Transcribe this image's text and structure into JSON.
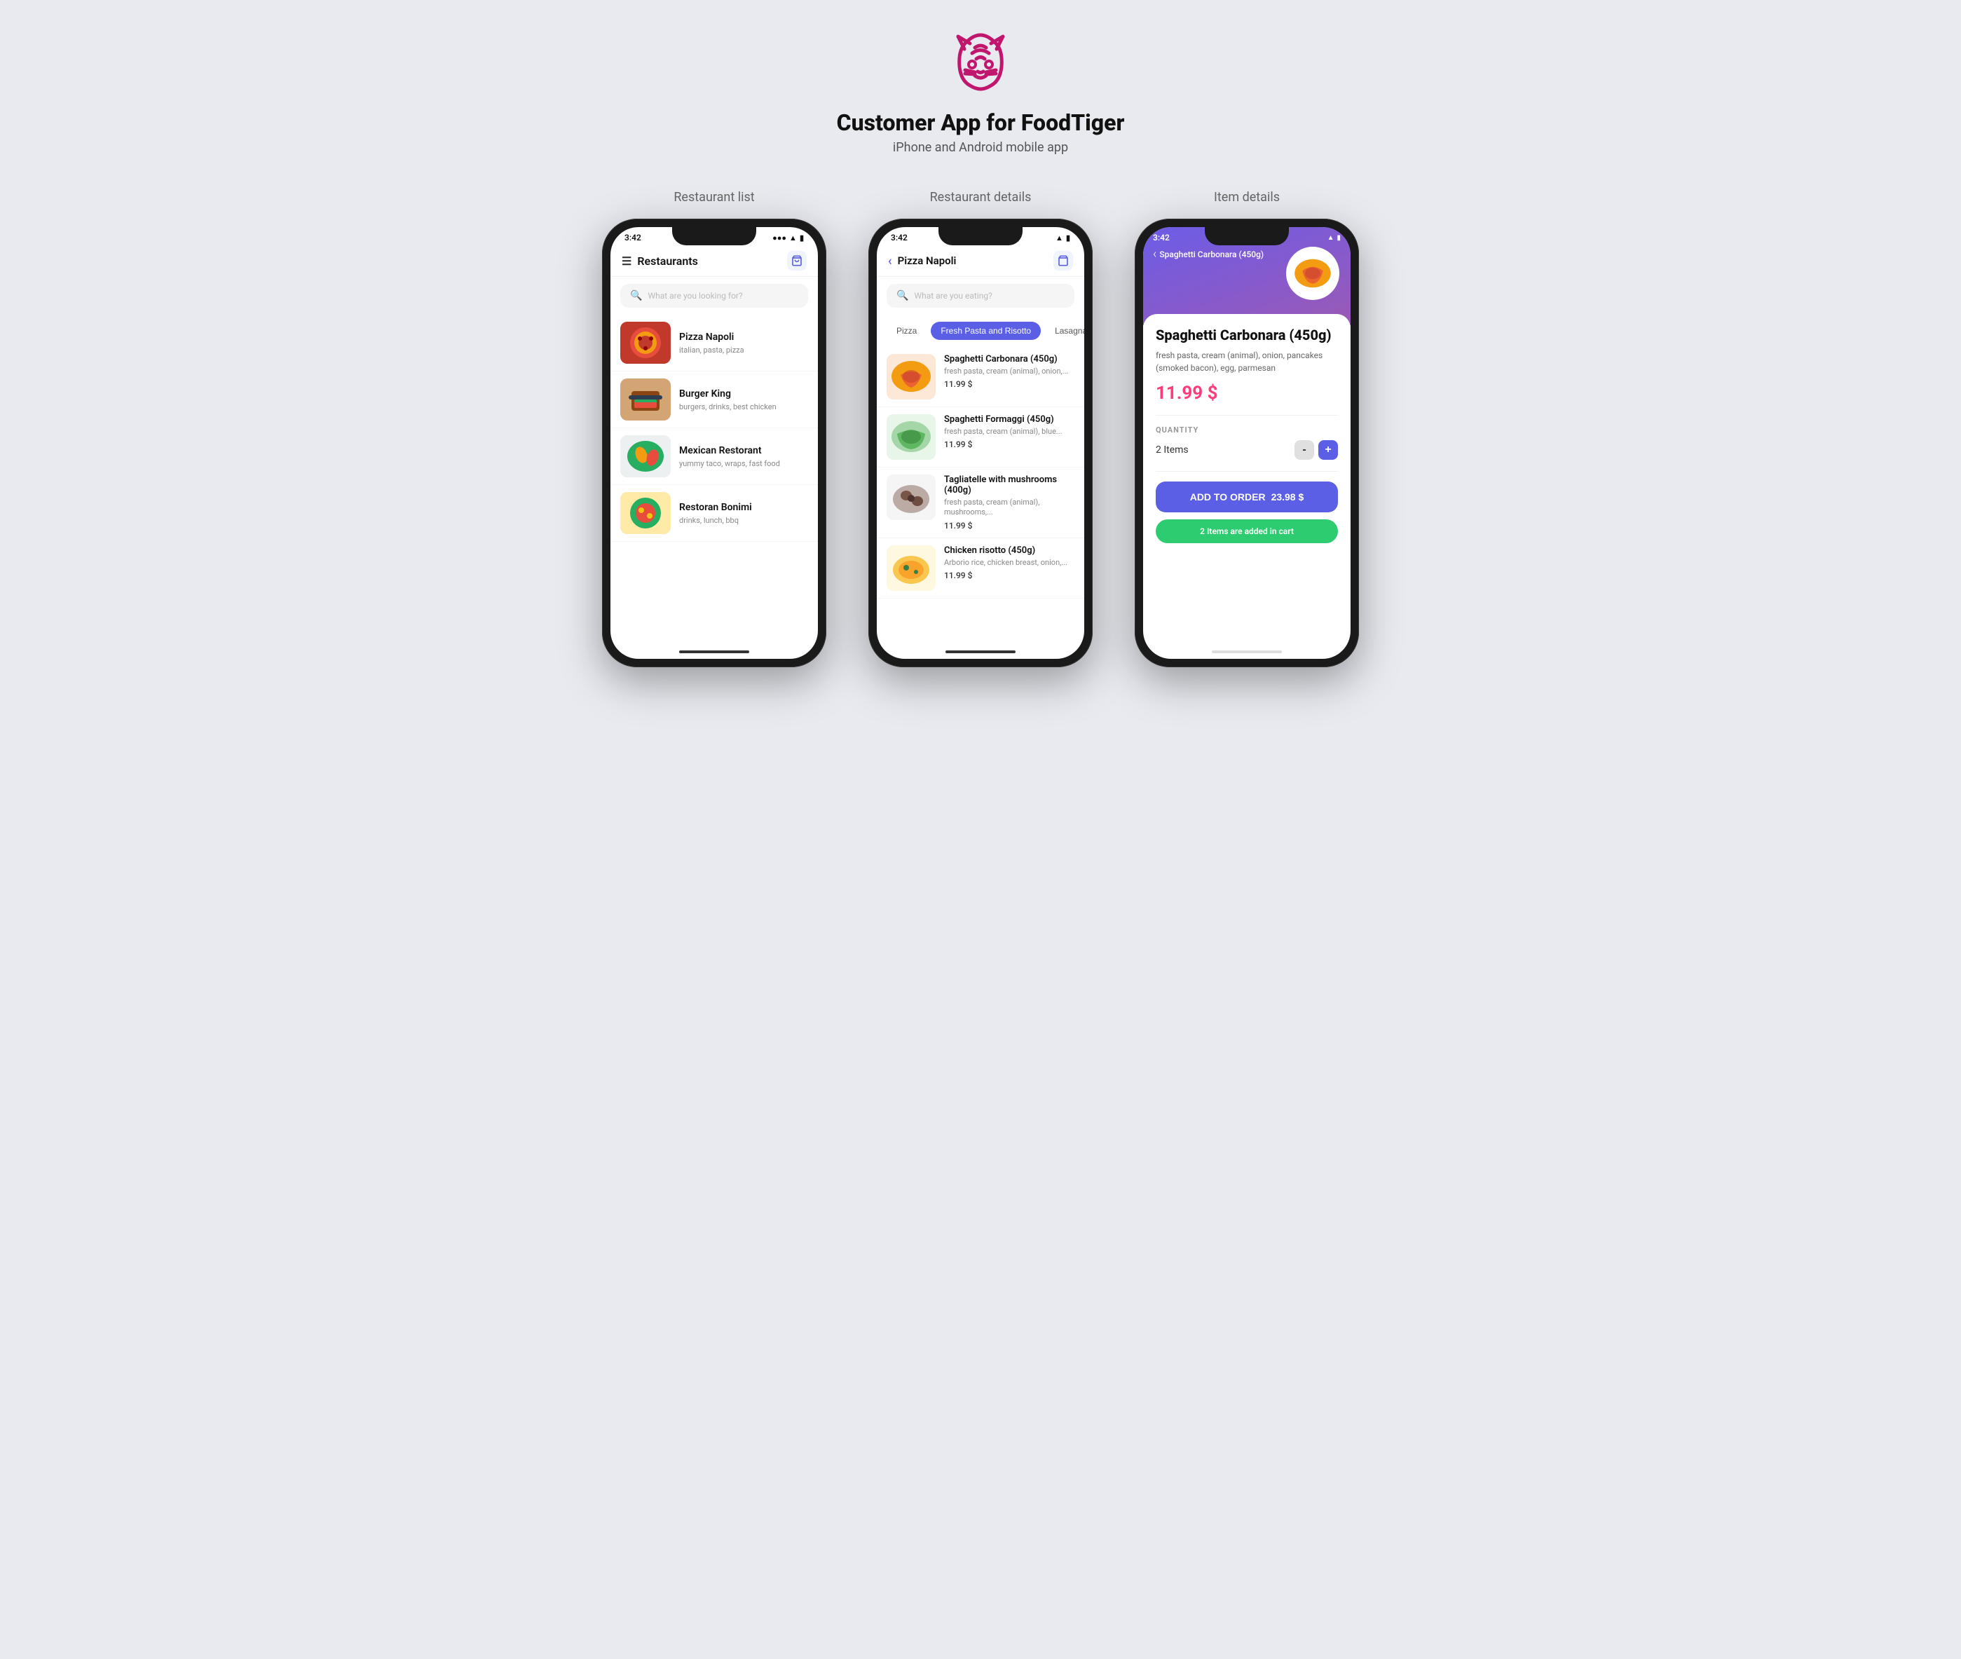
{
  "app": {
    "logo_alt": "FoodTiger tiger logo",
    "title": "Customer App for FoodTiger",
    "subtitle": "iPhone and Android mobile app"
  },
  "sections": [
    {
      "label": "Restaurant list"
    },
    {
      "label": "Restaurant details"
    },
    {
      "label": "Item details"
    }
  ],
  "phone1": {
    "status_time": "3:42",
    "nav_title": "Restaurants",
    "search_placeholder": "What are you looking for?",
    "restaurants": [
      {
        "name": "Pizza Napoli",
        "tags": "italian, pasta, pizza",
        "color1": "#c0392b",
        "color2": "#e67e22"
      },
      {
        "name": "Burger King",
        "tags": "burgers, drinks, best chicken",
        "color1": "#d35400",
        "color2": "#e67e22"
      },
      {
        "name": "Mexican Restorant",
        "tags": "yummy taco, wraps, fast food",
        "color1": "#27ae60",
        "color2": "#2ecc71"
      },
      {
        "name": "Restoran Bonimi",
        "tags": "drinks, lunch, bbq",
        "color1": "#16a085",
        "color2": "#1abc9c"
      }
    ]
  },
  "phone2": {
    "status_time": "3:42",
    "nav_back": "Pizza Napoli",
    "search_placeholder": "What are you eating?",
    "tabs": [
      {
        "label": "Pizza",
        "active": false
      },
      {
        "label": "Fresh Pasta and Risotto",
        "active": true
      },
      {
        "label": "Lasagna",
        "active": false
      }
    ],
    "menu_items": [
      {
        "name": "Spaghetti Carbonara (450g)",
        "desc": "fresh pasta, cream (animal), onion,...",
        "price": "11.99 $",
        "color1": "#e74c3c",
        "color2": "#c0392b"
      },
      {
        "name": "Spaghetti Formaggi (450g)",
        "desc": "fresh pasta, cream (animal), blue...",
        "price": "11.99 $",
        "color1": "#27ae60",
        "color2": "#2ecc71"
      },
      {
        "name": "Tagliatelle with mushrooms (400g)",
        "desc": "fresh pasta, cream (animal), mushrooms,...",
        "price": "11.99 $",
        "color1": "#7f8c8d",
        "color2": "#95a5a6"
      },
      {
        "name": "Chicken risotto (450g)",
        "desc": "Arborio rice, chicken breast, onion,...",
        "price": "11.99 $",
        "color1": "#f39c12",
        "color2": "#e67e22"
      }
    ]
  },
  "phone3": {
    "status_time": "3:42",
    "nav_back": "Spaghetti Carbonara (450g)",
    "item_title": "Spaghetti Carbonara (450g)",
    "item_desc": "fresh pasta, cream (animal), onion, pancakes (smoked bacon), egg, parmesan",
    "item_price": "11.99 $",
    "quantity_label": "QUANTITY",
    "quantity_text": "2 Items",
    "quantity_value": 2,
    "minus_label": "-",
    "plus_label": "+",
    "add_to_order_label": "ADD TO ORDER",
    "add_to_order_price": "23.98 $",
    "cart_message": "2 Items are added in cart",
    "header_bg": "#6c5ce7"
  }
}
